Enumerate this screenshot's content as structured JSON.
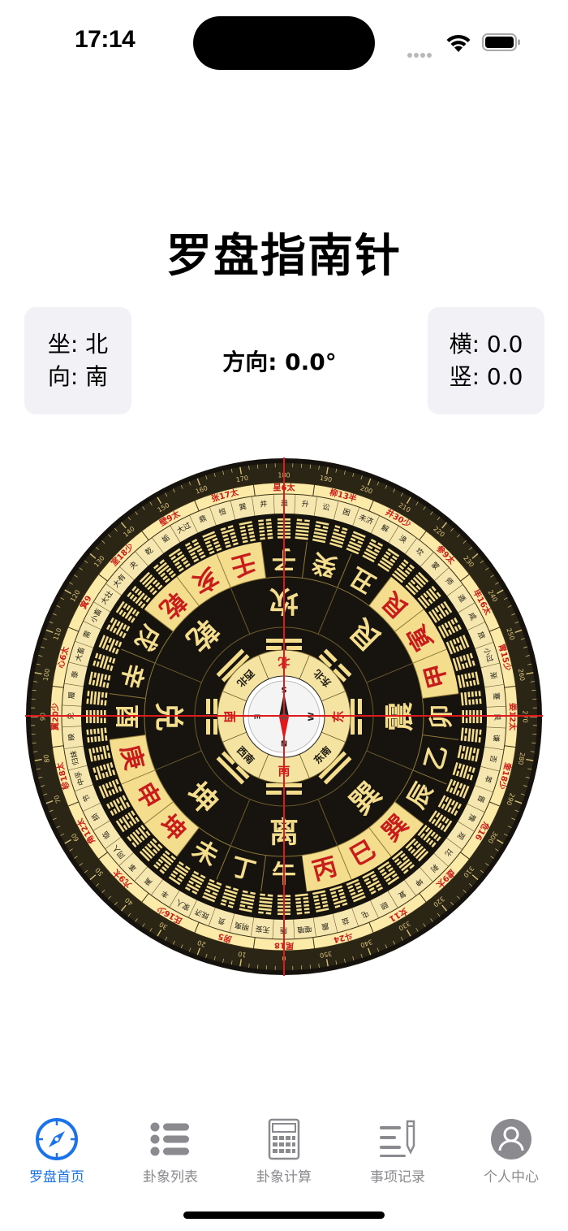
{
  "status_bar": {
    "time": "17:14"
  },
  "header": {
    "title": "罗盘指南针"
  },
  "info": {
    "sit_label": "坐: 北",
    "face_label": "向: 南",
    "direction": "方向: 0.0°",
    "horizontal": "横: 0.0",
    "vertical": "竖: 0.0"
  },
  "compass": {
    "heading_deg": 0,
    "outer_mountains": [
      "午",
      "丁",
      "未",
      "坤",
      "申",
      "庚",
      "酉",
      "辛",
      "戌",
      "乾",
      "亥",
      "壬",
      "子",
      "癸",
      "丑",
      "艮",
      "寅",
      "甲",
      "卯",
      "乙",
      "辰",
      "巽",
      "巳",
      "丙"
    ],
    "highlight_mountains": [
      "坤",
      "申",
      "庚",
      "乾",
      "亥",
      "壬",
      "艮",
      "寅",
      "甲",
      "巽",
      "巳",
      "丙"
    ],
    "trigrams": [
      "离",
      "坤",
      "兑",
      "乾",
      "坎",
      "艮",
      "震",
      "巽"
    ],
    "inner_directions": [
      "南",
      "西南",
      "西",
      "西北",
      "北",
      "东北",
      "东",
      "东南"
    ],
    "needle_letters": [
      "S",
      "W",
      "N",
      "E"
    ],
    "degree_labels": [
      "0",
      "10",
      "20",
      "30",
      "40",
      "50",
      "60",
      "70",
      "80",
      "90",
      "100",
      "110",
      "120",
      "130",
      "140",
      "150",
      "160",
      "170",
      "180",
      "190",
      "200",
      "210",
      "220",
      "230",
      "240",
      "250",
      "260",
      "270",
      "280",
      "290",
      "300",
      "310",
      "320",
      "330",
      "340",
      "350"
    ],
    "mansions": [
      "张17太",
      "星6太",
      "柳13半",
      "井30少",
      "参9太",
      "毕16太",
      "胃15少",
      "娄12太",
      "奎18少",
      "危16",
      "虚9太",
      "女11",
      "斗24",
      "尾18",
      "房5",
      "氐16少",
      "亢9太",
      "角12太",
      "轸18太",
      "翼20少",
      "心6太",
      "箕9",
      "室18少",
      "壁9太"
    ],
    "hexagrams_text": [
      "大过",
      "鼎",
      "恒",
      "巽",
      "井",
      "蛊",
      "升",
      "讼",
      "困",
      "未济",
      "解",
      "涣",
      "坎",
      "蒙",
      "师",
      "遁",
      "咸",
      "旅",
      "小过",
      "渐",
      "蹇",
      "艮",
      "谦",
      "否",
      "萃",
      "晋",
      "豫",
      "观",
      "比",
      "剥",
      "坤",
      "复",
      "颐",
      "屯",
      "益",
      "震",
      "噬嗑",
      "随",
      "无妄",
      "明夷",
      "贲",
      "既济",
      "家人",
      "丰",
      "离",
      "革",
      "同人",
      "临",
      "损",
      "节",
      "中孚",
      "归妹",
      "睽",
      "兑",
      "履",
      "泰",
      "大畜",
      "需",
      "小畜",
      "大壮",
      "大有",
      "夬",
      "乾",
      "姤"
    ]
  },
  "tabs": [
    {
      "label": "罗盘首页",
      "icon": "compass-icon",
      "active": true
    },
    {
      "label": "卦象列表",
      "icon": "list-icon",
      "active": false
    },
    {
      "label": "卦象计算",
      "icon": "calculator-icon",
      "active": false
    },
    {
      "label": "事项记录",
      "icon": "notes-icon",
      "active": false
    },
    {
      "label": "个人中心",
      "icon": "person-icon",
      "active": false
    }
  ],
  "colors": {
    "accent": "#1a73e8",
    "crosshair": "#e0191c",
    "gold": "#f4dd8c",
    "pale_gold": "#fbeaa8",
    "dark": "#16130f",
    "red_text": "#c81b1b"
  }
}
